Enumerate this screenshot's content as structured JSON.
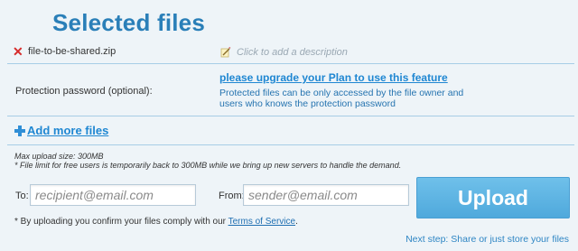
{
  "page": {
    "title": "Selected files"
  },
  "files": [
    {
      "name": "file-to-be-shared.zip",
      "description_placeholder": "Click to add a description"
    }
  ],
  "protection": {
    "label": "Protection password (optional):",
    "upgrade_link": "please upgrade your Plan to use this feature",
    "note": "Protected files can be only accessed by the file owner and users who knows the protection password"
  },
  "add_more": {
    "label": "Add more files"
  },
  "limits": {
    "max_size": "Max upload size: 300MB",
    "notice": "* File limit for free users is temporarily back to 300MB while we bring up new servers to handle the demand."
  },
  "form": {
    "to_label": "To:",
    "to_placeholder": "recipient@email.com",
    "from_label": "From:",
    "from_placeholder": "sender@email.com",
    "upload_label": "Upload"
  },
  "terms": {
    "prefix": "* By uploading you confirm your files comply with our ",
    "link": "Terms of Service",
    "suffix": "."
  },
  "footer": {
    "next_step": "Next step: Share or just store your files"
  },
  "colors": {
    "accent": "#2a7fb8",
    "link": "#1f87d2",
    "upload_button": "#5db3e2",
    "remove": "#d62b2b",
    "divider": "#a7cde6"
  }
}
